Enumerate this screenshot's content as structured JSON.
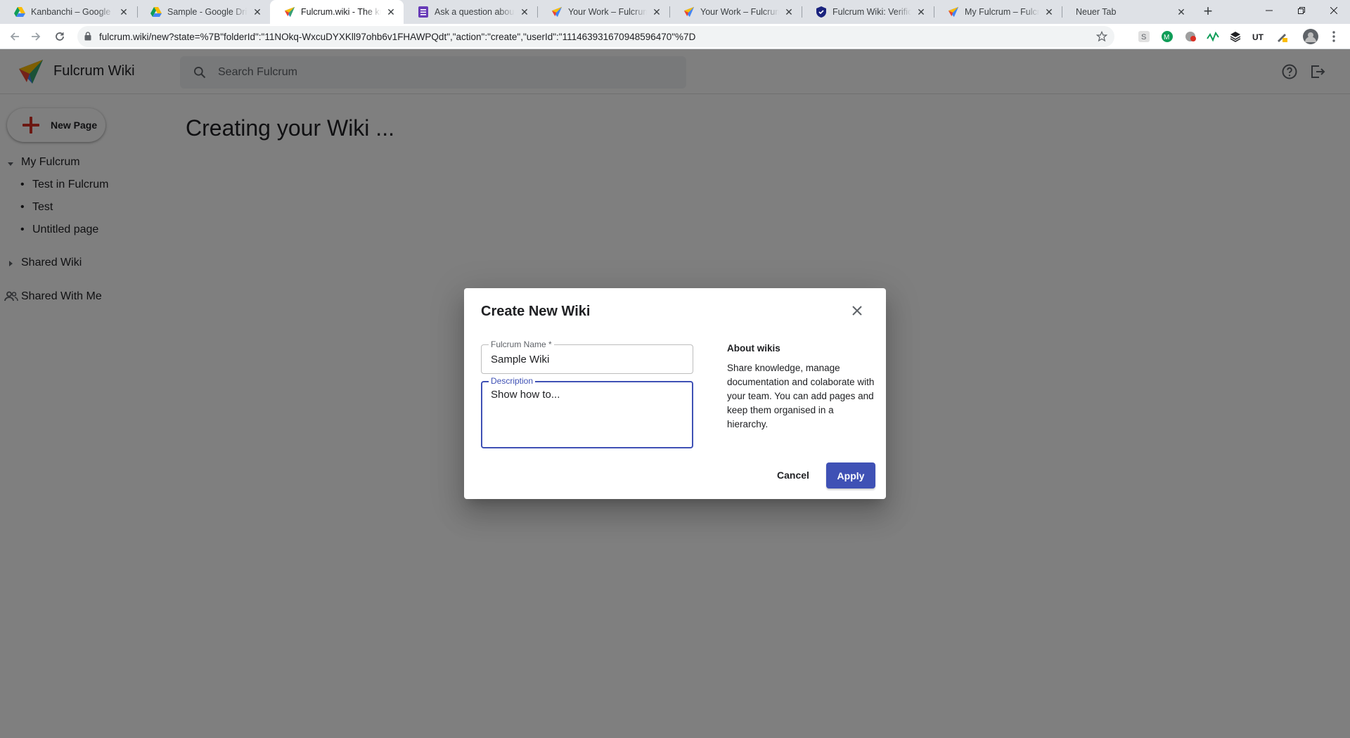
{
  "browser": {
    "tabs": [
      {
        "title": "Kanbanchi – Google Dr",
        "favicon": "google-drive-icon"
      },
      {
        "title": "Sample - Google Drive",
        "favicon": "google-drive-icon"
      },
      {
        "title": "Fulcrum.wiki - The know",
        "favicon": "fulcrum-logo-icon",
        "active": true
      },
      {
        "title": "Ask a question about Fu",
        "favicon": "form-icon"
      },
      {
        "title": "Your Work – Fulcrum.wi",
        "favicon": "fulcrum-logo-icon"
      },
      {
        "title": "Your Work – Fulcrum.wi",
        "favicon": "fulcrum-logo-icon"
      },
      {
        "title": "Fulcrum Wiki: Verificati",
        "favicon": "shield-icon"
      },
      {
        "title": "My Fulcrum – Fulcrum.",
        "favicon": "fulcrum-logo-icon"
      },
      {
        "title": "Neuer Tab",
        "favicon": ""
      }
    ],
    "url": "fulcrum.wiki/new?state=%7B\"folderId\":\"11NOkq-WxcuDYXKll97ohb6v1FHAWPQdt\",\"action\":\"create\",\"userId\":\"111463931670948596470\"%7D"
  },
  "app": {
    "brand": "Fulcrum Wiki",
    "search_placeholder": "Search Fulcrum",
    "new_page_label": "New Page",
    "heading": "Creating your Wiki ..."
  },
  "sidebar": {
    "my_fulcrum": {
      "label": "My Fulcrum",
      "expanded": true,
      "children": [
        "Test in Fulcrum",
        "Test",
        "Untitled page"
      ]
    },
    "shared_wiki": {
      "label": "Shared Wiki",
      "expanded": false
    },
    "shared_with_me": {
      "label": "Shared With Me"
    }
  },
  "dialog": {
    "title": "Create New Wiki",
    "name_label": "Fulcrum Name *",
    "name_value": "Sample Wiki",
    "description_label": "Description",
    "description_value": "Show how to...",
    "about_title": "About wikis",
    "about_body": "Share knowledge, manage documentation and colaborate with your team. You can add pages and keep them organised in a hierarchy.",
    "cancel_label": "Cancel",
    "apply_label": "Apply"
  },
  "colors": {
    "primary": "#3f51b5",
    "new_page_plus": "#d93025",
    "scrim": "rgba(0,0,0,0.5)"
  }
}
